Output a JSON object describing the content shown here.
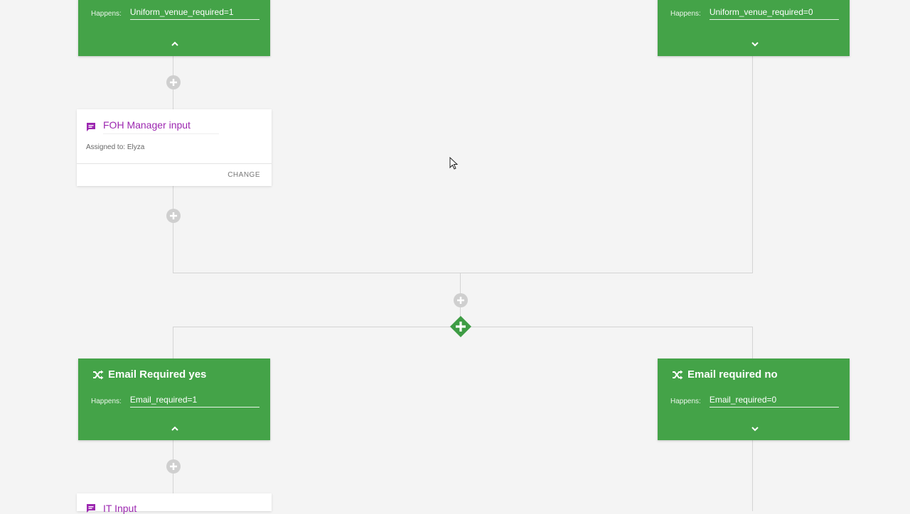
{
  "colors": {
    "branch_green": "#44a348",
    "task_purple": "#9c27b0",
    "connector_gray": "#d4d4d4",
    "add_button_gray": "#cfcfcf",
    "gateway_green": "#3e9c44"
  },
  "top_branches": {
    "left": {
      "happens_label": "Happens:",
      "condition": "Uniform_venue_required=1",
      "chevron_icon": "chevron-up-icon"
    },
    "right": {
      "happens_label": "Happens:",
      "condition": "Uniform_venue_required=0",
      "chevron_icon": "chevron-down-icon"
    }
  },
  "tasks": {
    "foh": {
      "icon": "comment-icon",
      "title": "FOH Manager input",
      "assigned_label": "Assigned to:",
      "assignee": "Elyza",
      "change_label": "CHANGE"
    },
    "it": {
      "icon": "comment-icon",
      "title": "IT Input"
    }
  },
  "gateway": {
    "icon": "parallel-gateway-icon"
  },
  "bottom_branches": {
    "left": {
      "icon": "shuffle-icon",
      "title": "Email Required yes",
      "happens_label": "Happens:",
      "condition": "Email_required=1",
      "chevron_icon": "chevron-up-icon"
    },
    "right": {
      "icon": "shuffle-icon",
      "title": "Email required no",
      "happens_label": "Happens:",
      "condition": "Email_required=0",
      "chevron_icon": "chevron-down-icon"
    }
  }
}
